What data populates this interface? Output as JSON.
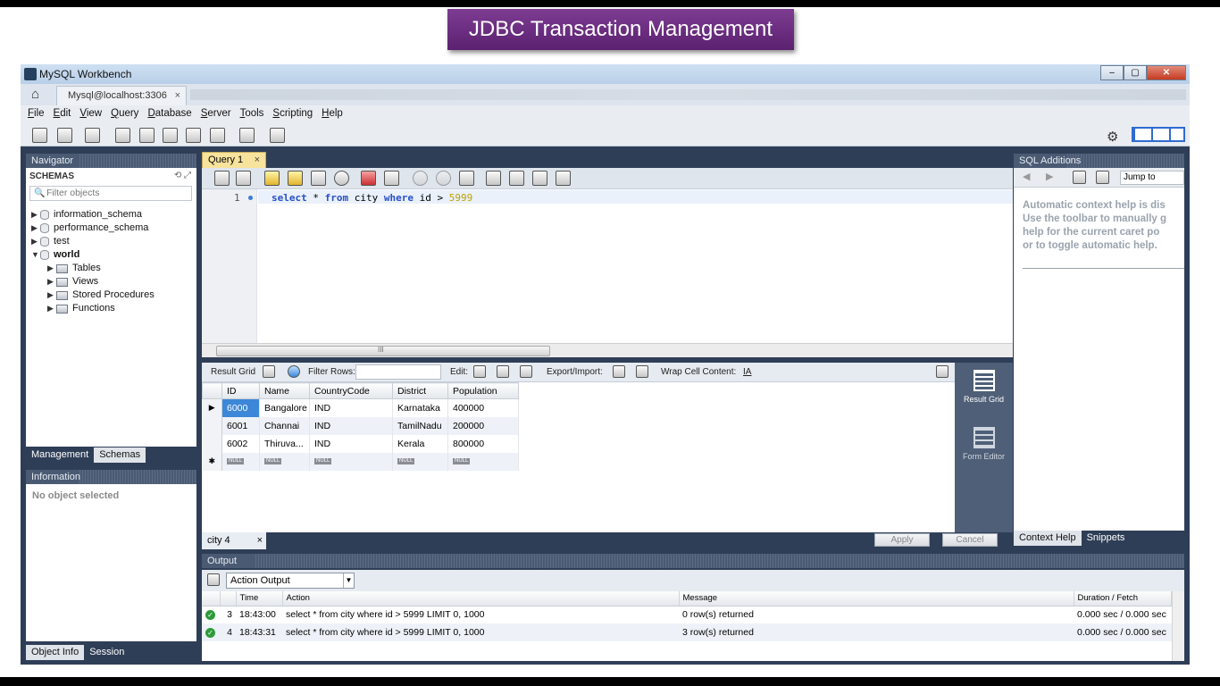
{
  "banner": {
    "title": "JDBC Transaction Management"
  },
  "window": {
    "title": "MySQL Workbench",
    "min": "–",
    "max": "▢",
    "close": "✕"
  },
  "conn_tab": {
    "label": "Mysql@localhost:3306",
    "close": "×"
  },
  "menu": [
    "File",
    "Edit",
    "View",
    "Query",
    "Database",
    "Server",
    "Tools",
    "Scripting",
    "Help"
  ],
  "navigator": {
    "header": "Navigator",
    "schemas_label": "SCHEMAS",
    "schemas_icons": "⟲ ⤢",
    "filter_placeholder": "Filter objects",
    "schemas": [
      "information_schema",
      "performance_schema",
      "test",
      "world"
    ],
    "world_children": [
      "Tables",
      "Views",
      "Stored Procedures",
      "Functions"
    ],
    "tabs": [
      "Management",
      "Schemas"
    ]
  },
  "information": {
    "header": "Information",
    "text": "No object selected",
    "tabs": [
      "Object Info",
      "Session"
    ]
  },
  "query": {
    "tab_label": "Query 1",
    "tab_close": "×",
    "line_number": "1",
    "sql_kw1": "select",
    "sql_p1": " * ",
    "sql_kw2": "from",
    "sql_p2": " city ",
    "sql_kw3": "where",
    "sql_p3": " id > ",
    "sql_num": "5999",
    "scroll_grip": "III"
  },
  "result_toolbar": {
    "result_grid": "Result Grid",
    "filter_rows": "Filter Rows:",
    "edit": "Edit:",
    "export_import": "Export/Import:",
    "wrap": "Wrap Cell Content:"
  },
  "grid": {
    "columns": [
      "ID",
      "Name",
      "CountryCode",
      "District",
      "Population"
    ],
    "rows": [
      [
        "6000",
        "Bangalore",
        "IND",
        "Karnataka",
        "400000"
      ],
      [
        "6001",
        "Channai",
        "IND",
        "TamilNadu",
        "200000"
      ],
      [
        "6002",
        "Thiruva...",
        "IND",
        "Kerala",
        "800000"
      ]
    ],
    "null_label": "NULL",
    "new_row_marker": "✱",
    "current_row_marker": "▶"
  },
  "rail": {
    "result_grid": "Result Grid",
    "form_editor": "Form Editor"
  },
  "result_tab": {
    "label": "city 4",
    "close": "×"
  },
  "buttons": {
    "apply": "Apply",
    "cancel": "Cancel"
  },
  "sql_additions": {
    "header": "SQL Additions",
    "jump_to": "Jump to",
    "help_lines": [
      "Automatic context help is dis",
      "Use the toolbar to manually g",
      "help for the current caret po",
      "or to toggle automatic help."
    ],
    "tabs": [
      "Context Help",
      "Snippets"
    ]
  },
  "output": {
    "header": "Output",
    "selector": "Action Output",
    "columns": [
      "",
      "",
      "Time",
      "Action",
      "Message",
      "Duration / Fetch"
    ],
    "rows": [
      {
        "num": "3",
        "time": "18:43:00",
        "action": "select * from city where id > 5999 LIMIT 0, 1000",
        "message": "0 row(s) returned",
        "duration": "0.000 sec / 0.000 sec"
      },
      {
        "num": "4",
        "time": "18:43:31",
        "action": "select * from city where id > 5999 LIMIT 0, 1000",
        "message": "3 row(s) returned",
        "duration": "0.000 sec / 0.000 sec"
      }
    ]
  },
  "colors": {
    "accent": "#5b2170",
    "panel": "#2f3e57",
    "selected_cell": "#3d87d8",
    "query_tab": "#f8e39d"
  }
}
